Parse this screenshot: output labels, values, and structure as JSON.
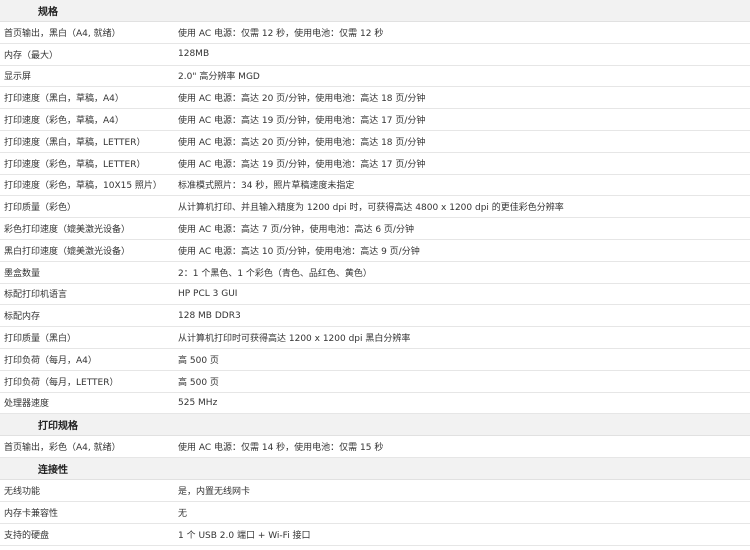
{
  "sections": [
    {
      "title": "规格",
      "rows": [
        {
          "label": "首页输出，黑白（A4, 就绪）",
          "value": "使用 AC 电源：仅需 12 秒，使用电池：仅需 12 秒"
        },
        {
          "label": "内存（最大）",
          "value": "128MB"
        },
        {
          "label": "显示屏",
          "value": "2.0\" 高分辨率 MGD"
        },
        {
          "label": "打印速度（黑白，草稿，A4）",
          "value": "使用 AC 电源：高达 20 页/分钟，使用电池：高达 18 页/分钟"
        },
        {
          "label": "打印速度（彩色，草稿，A4）",
          "value": "使用 AC 电源：高达 19 页/分钟，使用电池：高达 17 页/分钟"
        },
        {
          "label": "打印速度（黑白，草稿，LETTER）",
          "value": "使用 AC 电源：高达 20 页/分钟，使用电池：高达 18 页/分钟"
        },
        {
          "label": "打印速度（彩色，草稿，LETTER）",
          "value": "使用 AC 电源：高达 19 页/分钟，使用电池：高达 17 页/分钟"
        },
        {
          "label": "打印速度（彩色，草稿，10X15 照片）",
          "value": "标准模式照片：34 秒，照片草稿速度未指定"
        },
        {
          "label": "打印质量（彩色）",
          "value": "从计算机打印、并且输入精度为 1200 dpi 时，可获得高达 4800 x 1200 dpi 的更佳彩色分辨率"
        },
        {
          "label": "彩色打印速度（媲美激光设备）",
          "value": "使用 AC 电源：高达 7 页/分钟，使用电池：高达 6 页/分钟"
        },
        {
          "label": "黑白打印速度（媲美激光设备）",
          "value": "使用 AC 电源：高达 10 页/分钟，使用电池：高达 9 页/分钟"
        },
        {
          "label": "墨盒数量",
          "value": "2：1 个黑色、1 个彩色（青色、品红色、黄色）"
        },
        {
          "label": "标配打印机语言",
          "value": "HP PCL 3 GUI"
        },
        {
          "label": "标配内存",
          "value": "128 MB DDR3"
        },
        {
          "label": "打印质量（黑白）",
          "value": "从计算机打印时可获得高达 1200 x 1200 dpi 黑白分辨率"
        },
        {
          "label": "打印负荷（每月，A4）",
          "value": "高 500 页"
        },
        {
          "label": "打印负荷（每月，LETTER）",
          "value": "高 500 页"
        },
        {
          "label": "处理器速度",
          "value": "525 MHz"
        }
      ]
    },
    {
      "title": "打印规格",
      "rows": [
        {
          "label": "首页输出，彩色（A4, 就绪）",
          "value": "使用 AC 电源：仅需 14 秒，使用电池：仅需 15 秒"
        }
      ]
    },
    {
      "title": "连接性",
      "rows": [
        {
          "label": "无线功能",
          "value": "是，内置无线网卡"
        },
        {
          "label": "内存卡兼容性",
          "value": "无"
        },
        {
          "label": "支持的硬盘",
          "value": "1 个 USB 2.0 端口 + Wi-Fi 接口"
        }
      ]
    }
  ]
}
